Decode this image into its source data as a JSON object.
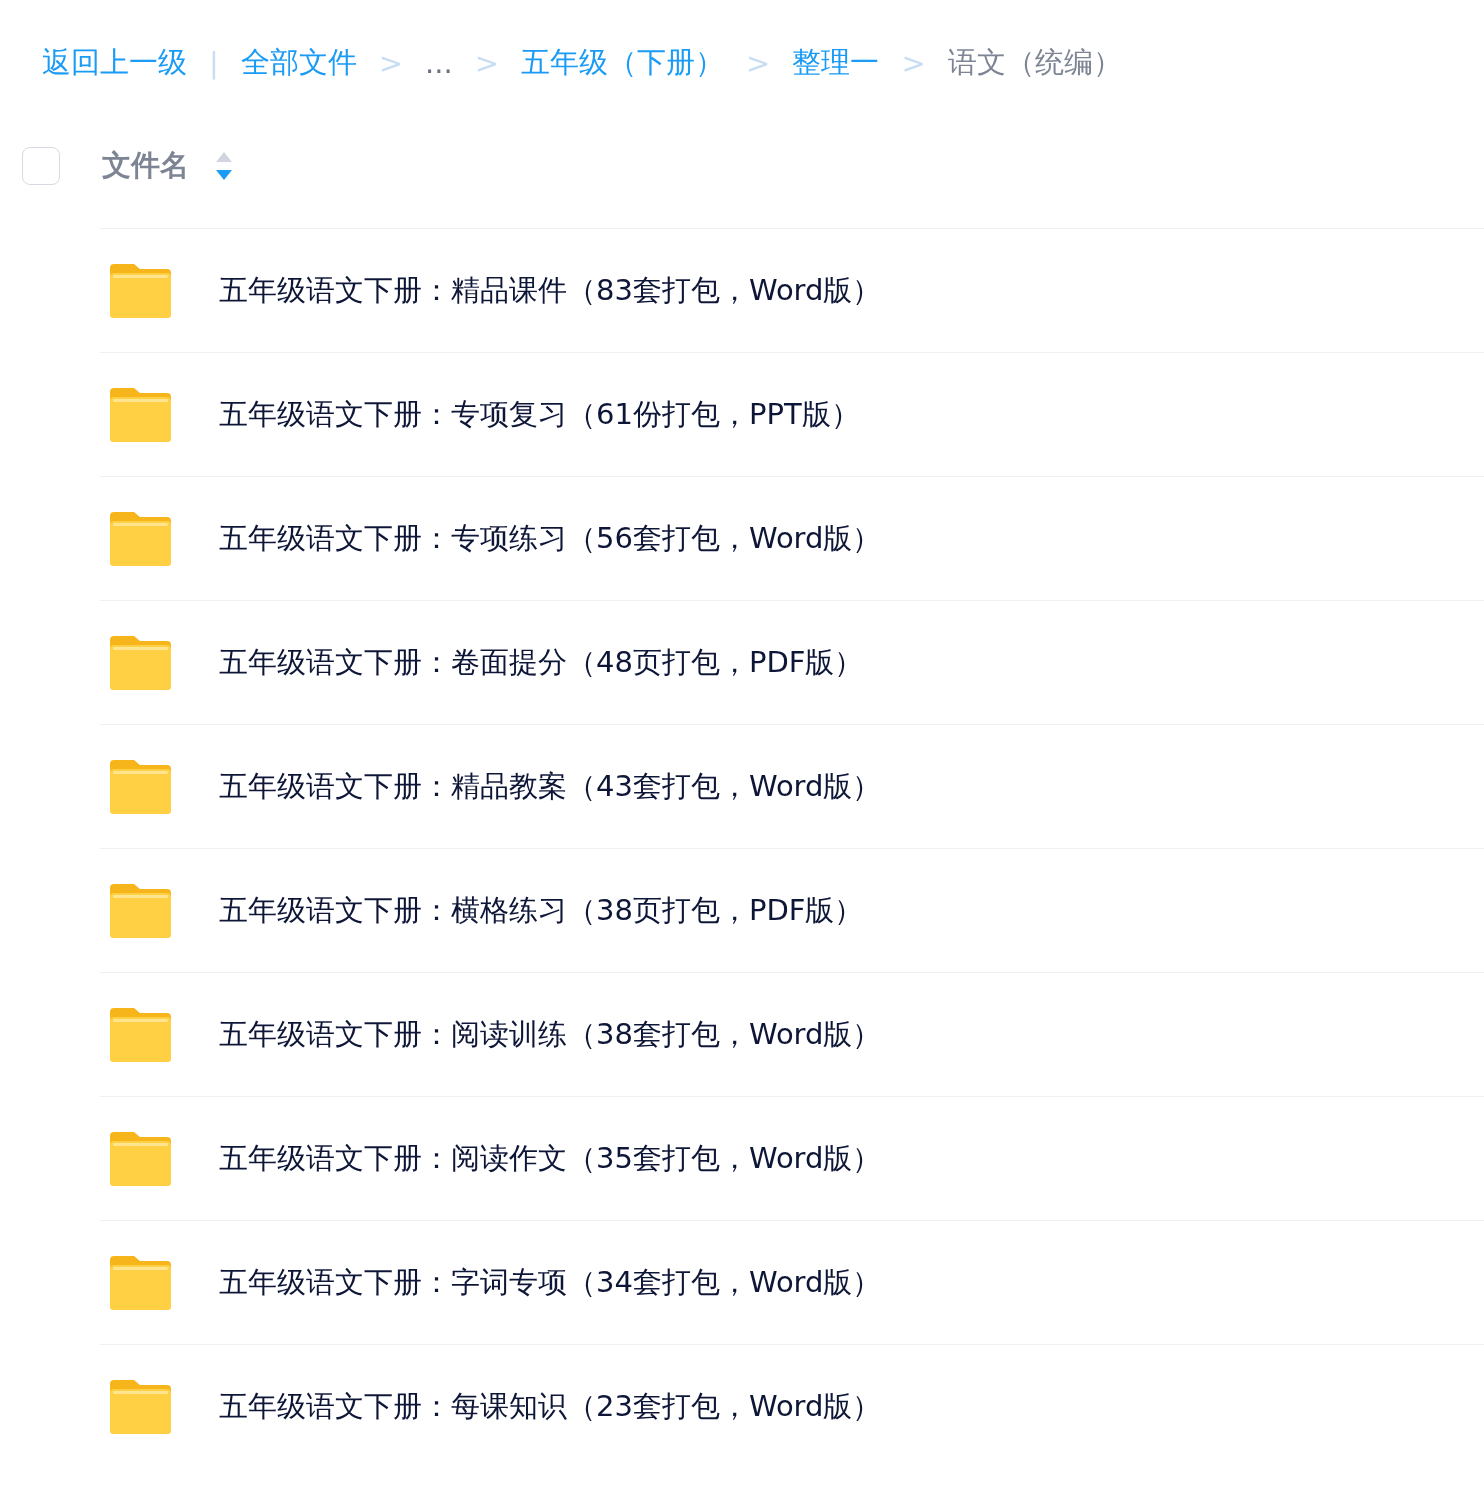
{
  "breadcrumb": {
    "back": "返回上一级",
    "divider": "|",
    "items": [
      {
        "label": "全部文件",
        "kind": "link"
      },
      {
        "separator": ">",
        "label": "...",
        "kind": "ellipsis"
      },
      {
        "separator": ">",
        "label": "五年级（下册）",
        "kind": "link"
      },
      {
        "separator": ">",
        "label": "整理一",
        "kind": "link"
      },
      {
        "separator": ">",
        "label": "语文（统编）",
        "kind": "current"
      }
    ]
  },
  "header": {
    "select_all": {
      "checked": false
    },
    "column": "文件名",
    "sort_descending": true
  },
  "files": [
    {
      "name": "五年级语文下册：精品课件（83套打包，Word版）",
      "kind": "folder"
    },
    {
      "name": "五年级语文下册：专项复习（61份打包，PPT版）",
      "kind": "folder"
    },
    {
      "name": "五年级语文下册：专项练习（56套打包，Word版）",
      "kind": "folder"
    },
    {
      "name": "五年级语文下册：卷面提分（48页打包，PDF版）",
      "kind": "folder"
    },
    {
      "name": "五年级语文下册：精品教案（43套打包，Word版）",
      "kind": "folder"
    },
    {
      "name": "五年级语文下册：横格练习（38页打包，PDF版）",
      "kind": "folder"
    },
    {
      "name": "五年级语文下册：阅读训练（38套打包，Word版）",
      "kind": "folder"
    },
    {
      "name": "五年级语文下册：阅读作文（35套打包，Word版）",
      "kind": "folder"
    },
    {
      "name": "五年级语文下册：字词专项（34套打包，Word版）",
      "kind": "folder"
    },
    {
      "name": "五年级语文下册：每课知识（23套打包，Word版）",
      "kind": "folder"
    }
  ]
}
